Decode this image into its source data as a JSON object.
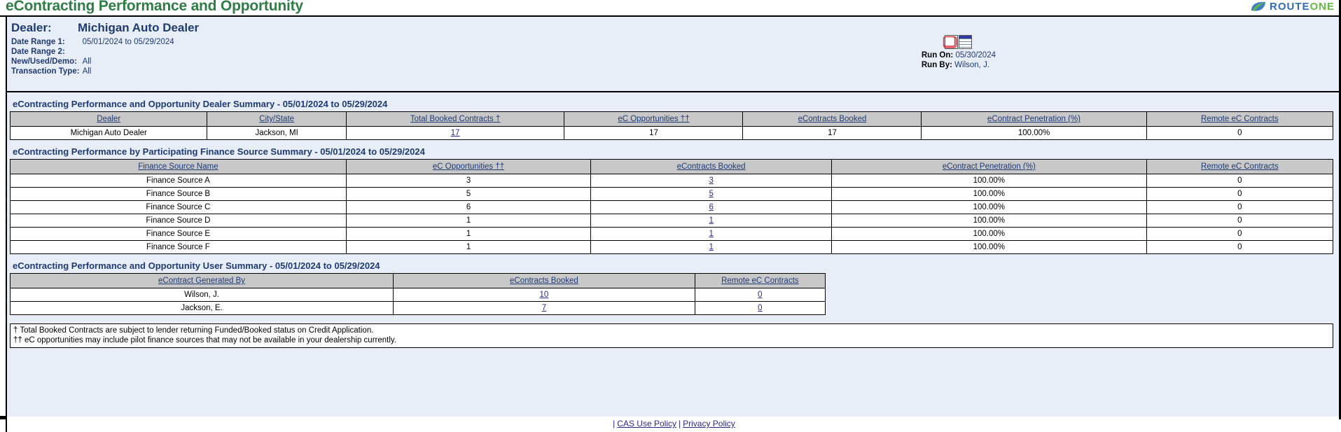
{
  "app": {
    "title": "eContracting Performance and Opportunity",
    "brand": {
      "part1": "ROUTE",
      "part2": "ONE"
    },
    "brand_colors": {
      "route": "#2f6cb4",
      "one": "#63bb46",
      "title": "#2e7d46",
      "heading": "#1f3a74"
    }
  },
  "header": {
    "dealer_label": "Dealer:",
    "dealer_name": "Michigan Auto Dealer",
    "criteria": [
      {
        "label": "Date Range 1:",
        "value": "05/01/2024 to 05/29/2024"
      },
      {
        "label": "Date Range 2:",
        "value": ""
      },
      {
        "label": "New/Used/Demo:",
        "value": "All"
      },
      {
        "label": "Transaction Type:",
        "value": "All"
      }
    ],
    "export": {
      "pdf_label": "PDF",
      "excel_label": "Excel"
    },
    "run_on_label": "Run On:",
    "run_on_value": "05/30/2024",
    "run_by_label": "Run By:",
    "run_by_value": "Wilson, J."
  },
  "dealer_summary": {
    "title": "eContracting Performance and Opportunity Dealer Summary - 05/01/2024 to 05/29/2024",
    "columns": [
      "Dealer",
      "City/State",
      "Total Booked Contracts †",
      "eC Opportunities ††",
      "eContracts Booked",
      "eContract Penetration (%)",
      "Remote eC Contracts"
    ],
    "rows": [
      {
        "dealer": "Michigan Auto Dealer",
        "city_state": "Jackson, MI",
        "total_booked_contracts": "17",
        "ec_opportunities": "17",
        "econtracts_booked": "17",
        "ec_penetration": "100.00%",
        "remote_ec_contracts": "0"
      }
    ]
  },
  "finance_source_summary": {
    "title": "eContracting Performance by Participating Finance Source Summary - 05/01/2024 to 05/29/2024",
    "columns": [
      "Finance Source Name",
      "eC Opportunities ††",
      "eContracts Booked",
      "eContract Penetration (%)",
      "Remote eC Contracts"
    ],
    "rows": [
      {
        "name": "Finance Source A",
        "ec_opportunities": "3",
        "econtracts_booked": "3",
        "ec_penetration": "100.00%",
        "remote_ec_contracts": "0"
      },
      {
        "name": "Finance Source B",
        "ec_opportunities": "5",
        "econtracts_booked": "5",
        "ec_penetration": "100.00%",
        "remote_ec_contracts": "0"
      },
      {
        "name": "Finance Source C",
        "ec_opportunities": "6",
        "econtracts_booked": "6",
        "ec_penetration": "100.00%",
        "remote_ec_contracts": "0"
      },
      {
        "name": "Finance Source D",
        "ec_opportunities": "1",
        "econtracts_booked": "1",
        "ec_penetration": "100.00%",
        "remote_ec_contracts": "0"
      },
      {
        "name": "Finance Source E",
        "ec_opportunities": "1",
        "econtracts_booked": "1",
        "ec_penetration": "100.00%",
        "remote_ec_contracts": "0"
      },
      {
        "name": "Finance Source F",
        "ec_opportunities": "1",
        "econtracts_booked": "1",
        "ec_penetration": "100.00%",
        "remote_ec_contracts": "0"
      }
    ]
  },
  "user_summary": {
    "title": "eContracting Performance and Opportunity User Summary - 05/01/2024 to 05/29/2024",
    "columns": [
      "eContract Generated By",
      "eContracts Booked",
      "Remote eC Contracts"
    ],
    "rows": [
      {
        "user": "Wilson, J.",
        "econtracts_booked": "10",
        "remote_ec_contracts": "0"
      },
      {
        "user": "Jackson, E.",
        "econtracts_booked": "7",
        "remote_ec_contracts": "0"
      }
    ]
  },
  "footnotes": [
    "† Total Booked Contracts are subject to lender returning Funded/Booked status on Credit Application.",
    "†† eC opportunities may include pilot finance sources that may not be available in your dealership currently."
  ],
  "footer": {
    "separator": "|",
    "links": [
      {
        "label": "CAS Use Policy"
      },
      {
        "label": "Privacy Policy"
      }
    ]
  }
}
